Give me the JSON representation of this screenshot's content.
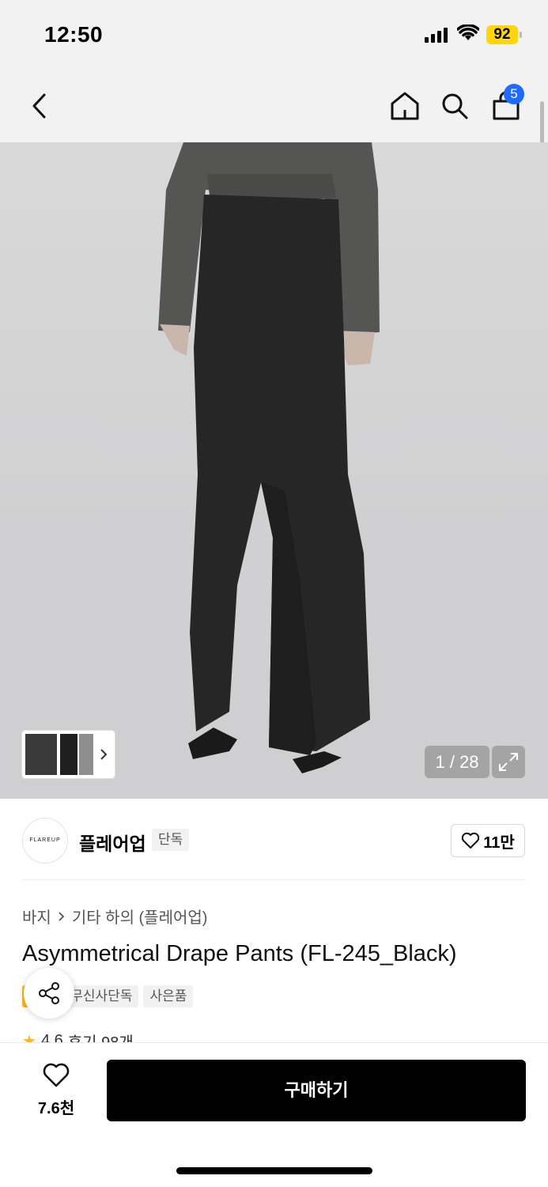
{
  "status_bar": {
    "time": "12:50",
    "battery": "92"
  },
  "nav": {
    "cart_count": "5"
  },
  "gallery": {
    "counter": "1 / 28"
  },
  "brand": {
    "logo_text": "FLAREUP",
    "name": "플레어업",
    "tag": "단독",
    "likes": "11만"
  },
  "breadcrumb": {
    "category": "바지",
    "subcategory": "기타 하의 (플레어업)"
  },
  "product": {
    "title": "Asymmetrical Drape Pants (FL-245_Black)",
    "badges": [
      "세일",
      "무신사단독",
      "사은품"
    ],
    "rating": "4.6",
    "reviews": "후기 98개"
  },
  "bottom": {
    "wish_count": "7.6천",
    "buy_label": "구매하기"
  },
  "colors": {
    "accent_badge": "#ffb619",
    "cart_badge": "#1f6bff",
    "buy_button": "#000000"
  }
}
